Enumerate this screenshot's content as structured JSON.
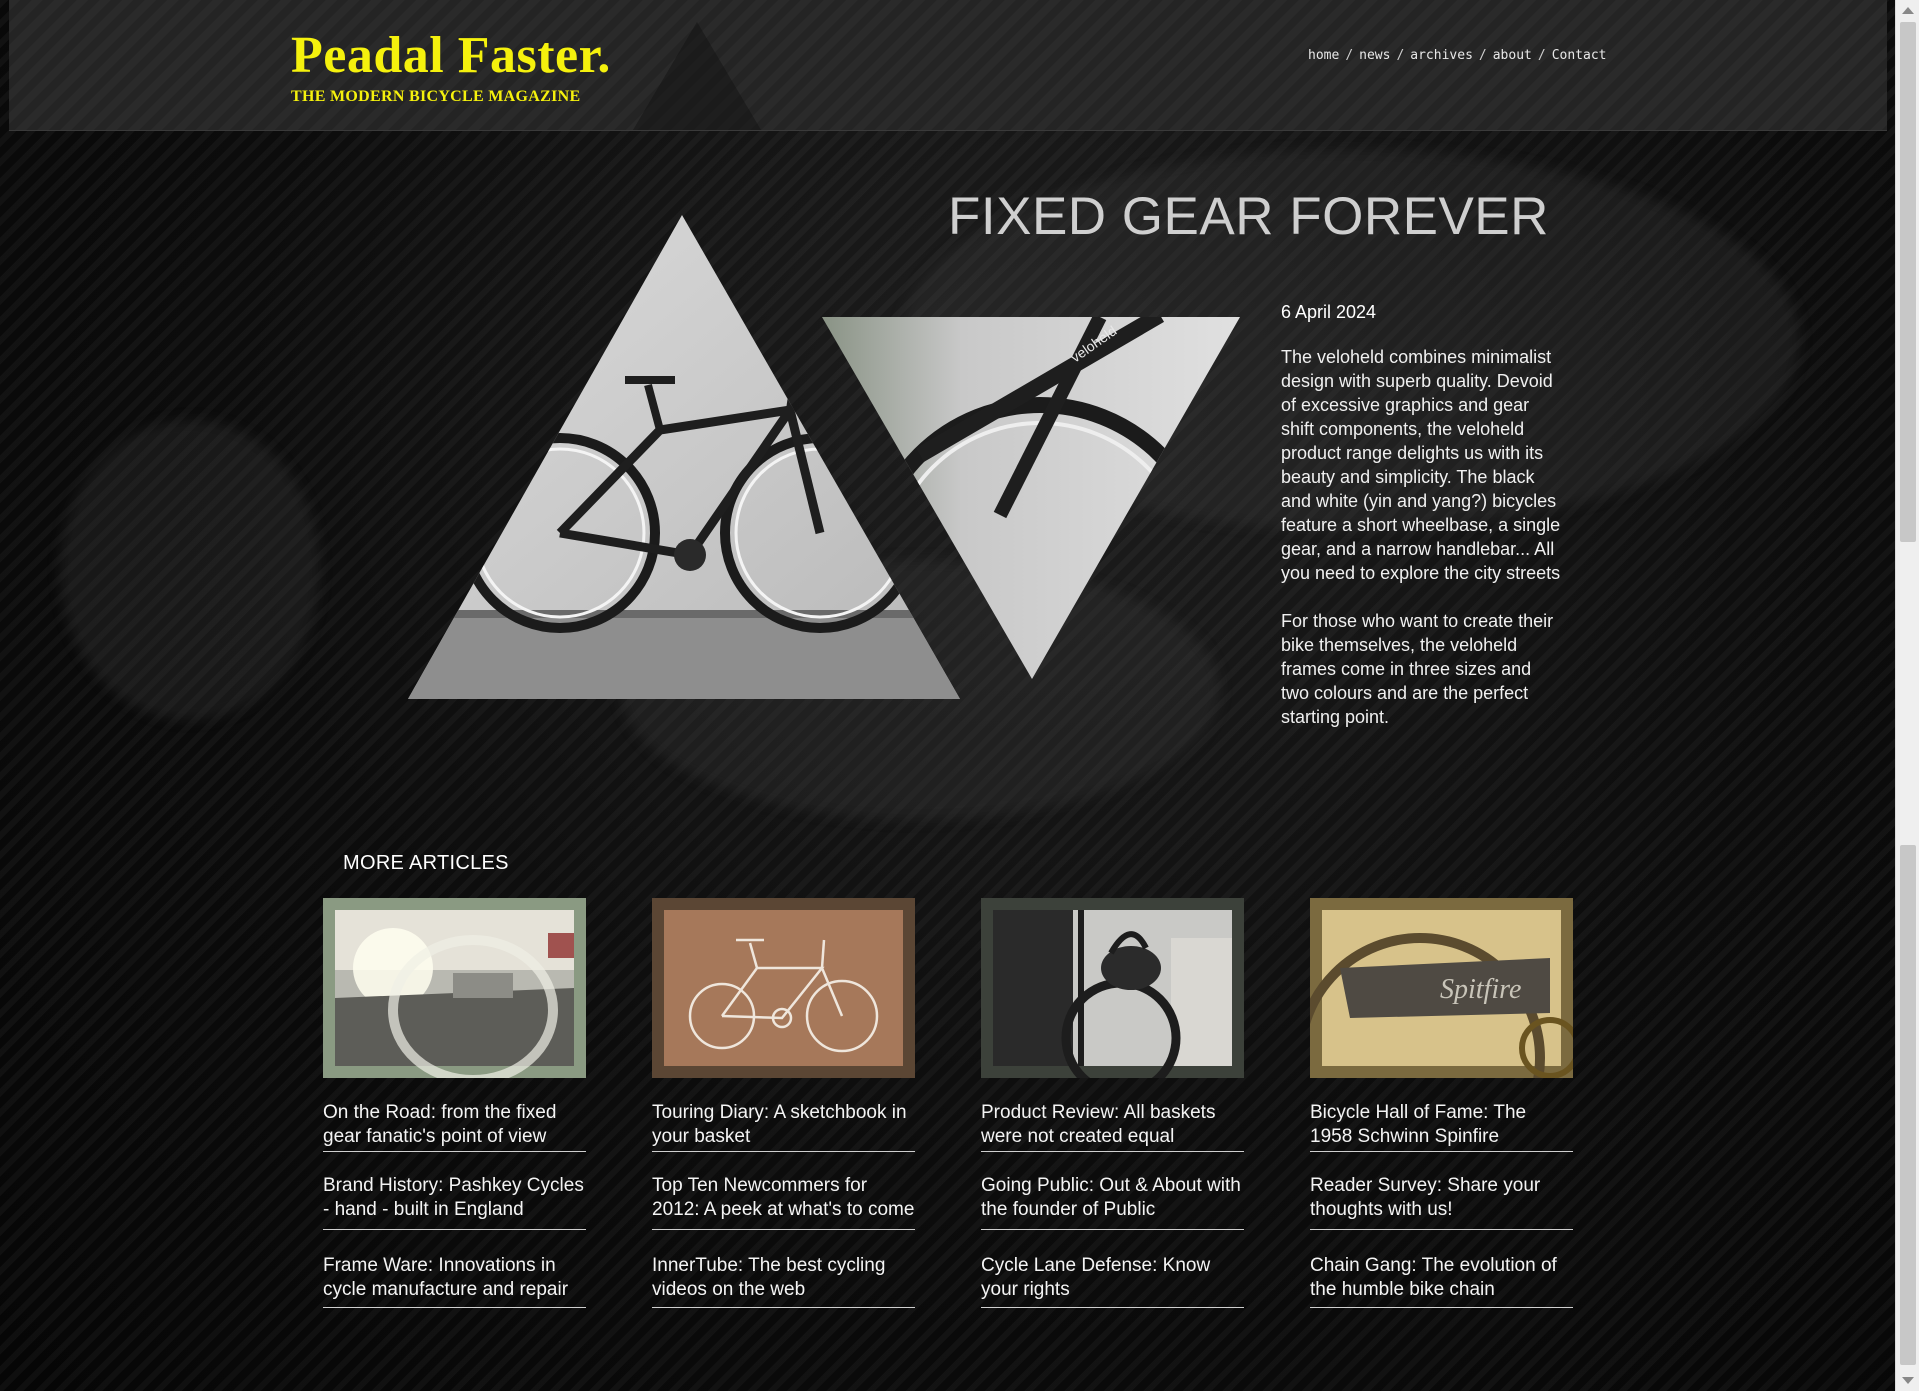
{
  "site": {
    "title": "Peadal Faster.",
    "subtitle": "THE MODERN BICYCLE MAGAZINE",
    "accent_color": "#f5f10d"
  },
  "nav": {
    "items": [
      "home",
      "news",
      "archives",
      "about",
      "Contact"
    ],
    "separator": "/"
  },
  "article": {
    "title": "FIXED GEAR FOREVER",
    "date": "6 April 2024",
    "paragraphs": [
      "The veloheld combines minimalist design with superb quality. Devoid of excessive graphics and gear shift components, the veloheld product range delights us with its beauty and simplicity. The black and white (yin and yang?) bicycles feature a short wheelbase, a single gear, and a narrow handlebar... All you need to explore the city streets",
      "For those who want to create their bike themselves, the veloheld frames come in three sizes and two colours and are the perfect starting point."
    ],
    "hero_image": "bicycle-photo-triangles",
    "frame_text": "veloheld"
  },
  "more_articles": {
    "heading": "MORE ARTICLES",
    "columns": [
      {
        "thumb_icon": "road-photo",
        "title": "On the Road: from the fixed gear fanatic's point of view",
        "items": [
          "Brand History: Pashkey Cycles - hand - built in England",
          "Frame Ware: Innovations in cycle manufacture and repair"
        ]
      },
      {
        "thumb_icon": "bicycle-sketch",
        "title": "Touring Diary: A sketchbook in your basket",
        "items": [
          "Top Ten Newcommers for 2012: A peek at what's to come",
          "InnerTube: The best cycling videos on the web"
        ]
      },
      {
        "thumb_icon": "basket-photo",
        "title": "Product Review: All baskets were not created equal",
        "items": [
          "Going Public: Out & About with the founder of Public",
          "Cycle Lane Defense: Know your rights"
        ]
      },
      {
        "thumb_icon": "schwinn-photo",
        "title": "Bicycle Hall of Fame: The 1958 Schwinn Spinfire",
        "items": [
          "Reader Survey: Share your thoughts with us!",
          "Chain Gang: The evolution of the humble bike chain"
        ],
        "thumb_text": "Spitfire"
      }
    ]
  }
}
